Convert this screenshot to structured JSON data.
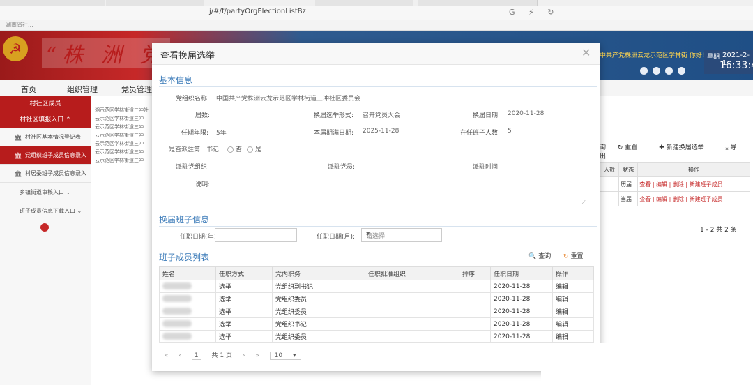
{
  "browser": {
    "url": "j/#/f/partyOrgElectionListBz",
    "bookmark": "湖南省社..."
  },
  "header": {
    "title": "“株 洲 党",
    "user_text": "中共产党株洲云龙示范区学林街 你好!",
    "date_label": "星期",
    "date": "2021-2-1",
    "time": "16:33:4"
  },
  "topnav": [
    "首页",
    "组织管理",
    "党员管理"
  ],
  "sidebar": {
    "section1": "村社区成员",
    "section2": "村社区填报入口",
    "items": [
      {
        "label": "村社区基本情况登记表",
        "active": false
      },
      {
        "label": "党组织班子成员信息录入",
        "active": true
      },
      {
        "label": "村居委班子成员信息录入",
        "active": false
      }
    ],
    "plain1": "乡镇街道审核入口",
    "plain2": "班子成员信息下载入口"
  },
  "background": {
    "tree_lines": [
      "湘示范区学林街道三冲社",
      "云示范区学林街道三冲",
      "云示范区学林街道三冲",
      "云示范区学林街道三冲",
      "云示范区学林街道三冲",
      "云示范区学林街道三冲",
      "云示范区学林街道三冲"
    ],
    "toolbar": {
      "query": "询",
      "reset": "重置",
      "new": "新建换届选举",
      "export": "导出"
    },
    "table_headers": [
      "人数",
      "状态",
      "操作"
    ],
    "rows": [
      {
        "status": "历届",
        "ops": "查看 | 编辑 | 删除 | 新建班子成员"
      },
      {
        "status": "当届",
        "ops": "查看 | 编辑 | 删除 | 新建班子成员"
      }
    ],
    "pager": "1 - 2  共 2 条"
  },
  "modal": {
    "title": "查看换届选举",
    "basic_info_title": "基本信息",
    "org_name_label": "党组织名称:",
    "org_name": "中国共产党株洲云龙示范区学林街道三冲社区委员会",
    "session_label": "届数:",
    "session": "",
    "form_label": "换届选举形式:",
    "form": "召开党员大会",
    "date_label": "换届日期:",
    "date": "2020-11-28",
    "term_label": "任期年限:",
    "term": "5年",
    "expire_label": "本届期满日期:",
    "expire": "2025-11-28",
    "count_label": "在任班子人数:",
    "count": "5",
    "secretary_label": "是否派驻第一书记:",
    "radio_no": "否",
    "radio_yes": "是",
    "dispatch_org_label": "派驻党组织:",
    "dispatch_member_label": "派驻党员:",
    "dispatch_time_label": "派驻时间:",
    "note_label": "说明:",
    "team_info_title": "换届班子信息",
    "year_label": "任职日期(年):",
    "year_value": "",
    "month_label": "任职日期(月):",
    "month_placeholder": "请选择",
    "members_title": "班子成员列表",
    "query_label": "查询",
    "reset_label": "重置",
    "columns": [
      "姓名",
      "任职方式",
      "党内职务",
      "任职批准组织",
      "排序",
      "任职日期",
      "操作"
    ],
    "rows": [
      {
        "method": "选举",
        "post": "党组织副书记",
        "date": "2020-11-28",
        "op": "编辑"
      },
      {
        "method": "选举",
        "post": "党组织委员",
        "date": "2020-11-28",
        "op": "编辑"
      },
      {
        "method": "选举",
        "post": "党组织委员",
        "date": "2020-11-28",
        "op": "编辑"
      },
      {
        "method": "选举",
        "post": "党组织书记",
        "date": "2020-11-28",
        "op": "编辑"
      },
      {
        "method": "选举",
        "post": "党组织委员",
        "date": "2020-11-28",
        "op": "编辑"
      }
    ],
    "pager": {
      "page": "1",
      "total": "共 1 页",
      "size": "10"
    }
  }
}
